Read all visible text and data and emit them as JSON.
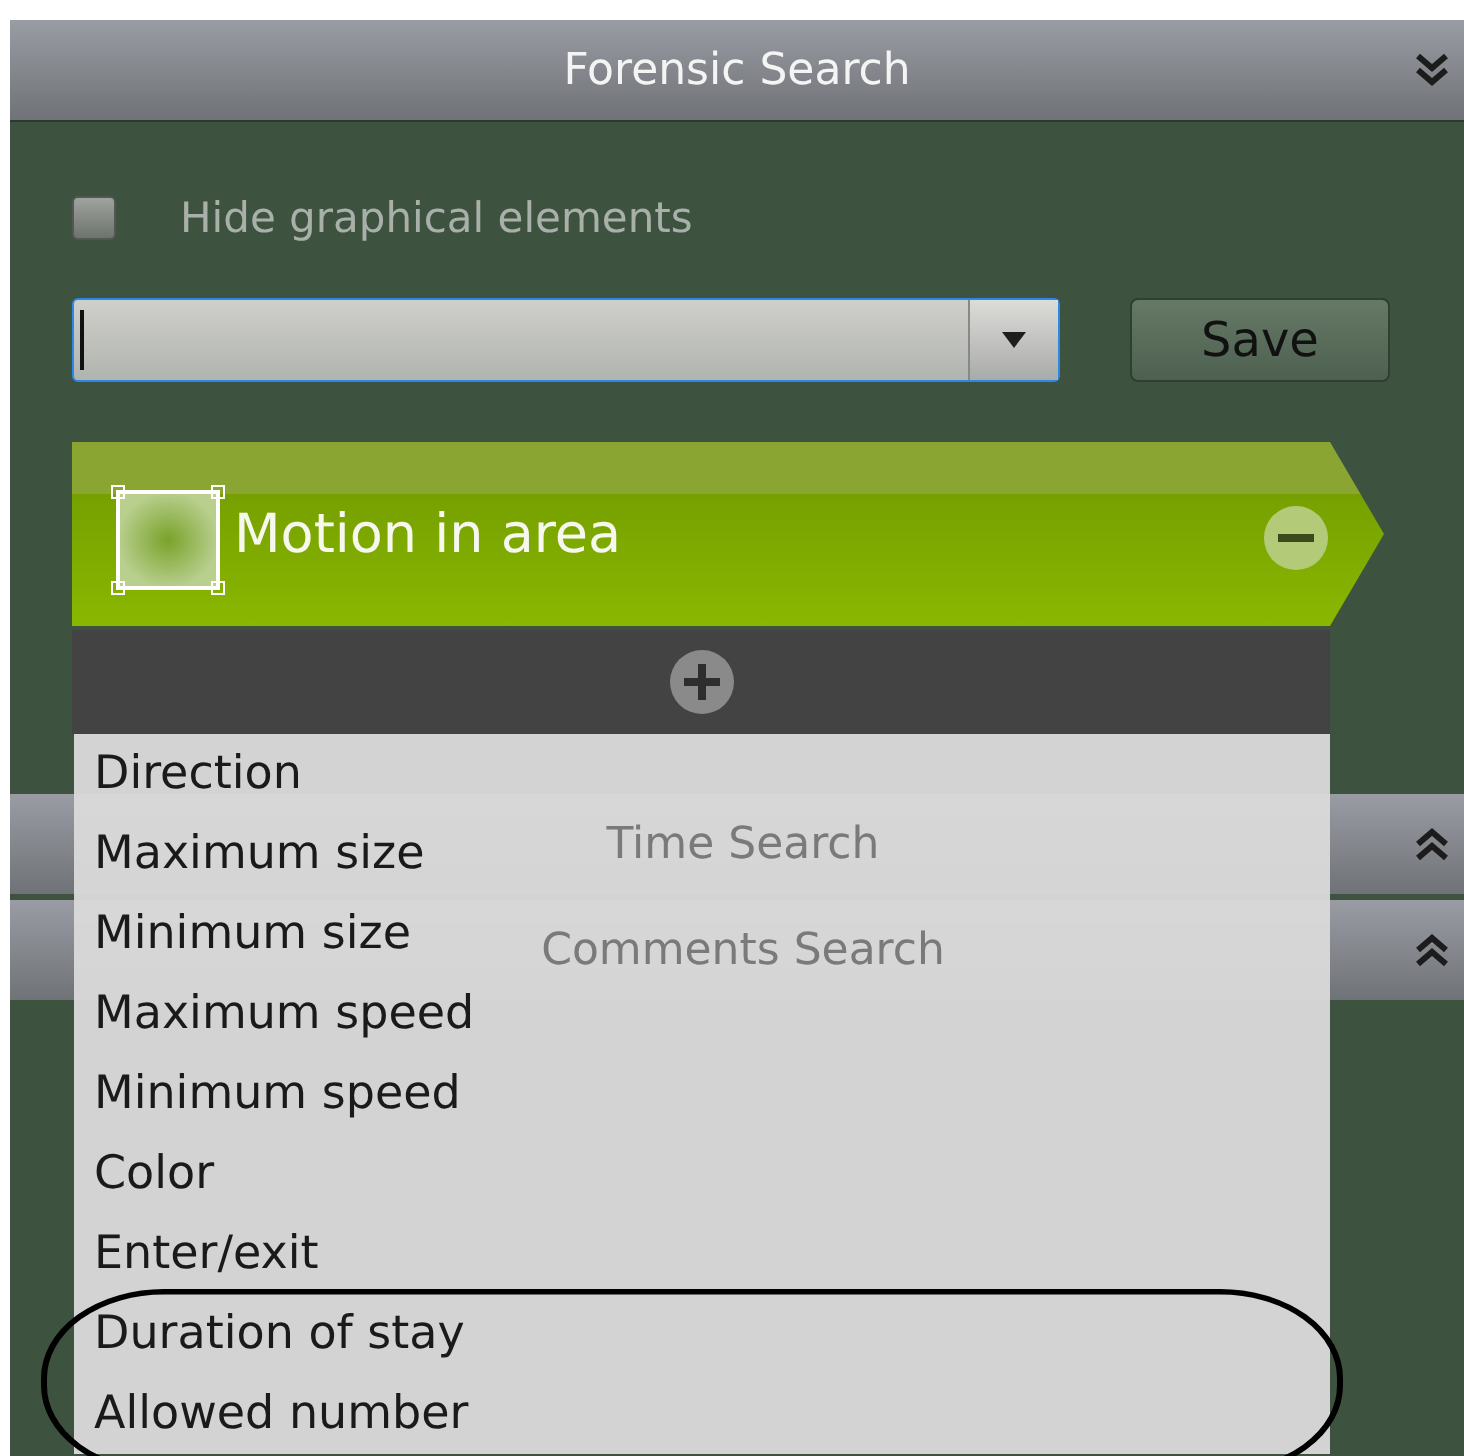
{
  "panel": {
    "title": "Forensic Search",
    "expanded": true
  },
  "hide_graphics": {
    "label": "Hide graphical elements",
    "checked": false
  },
  "save_button": {
    "label": "Save"
  },
  "filter": {
    "title": "Motion in area"
  },
  "condition_menu": {
    "items": [
      {
        "label": "Direction"
      },
      {
        "label": "Maximum size"
      },
      {
        "label": "Minimum size"
      },
      {
        "label": "Maximum speed"
      },
      {
        "label": "Minimum speed"
      },
      {
        "label": "Color"
      },
      {
        "label": "Enter/exit"
      },
      {
        "label": "Duration of stay",
        "circled": true
      },
      {
        "label": "Allowed number",
        "circled": true
      }
    ]
  },
  "sections": [
    {
      "title": "Time Search",
      "expanded": false
    },
    {
      "title": "Comments Search",
      "expanded": false
    }
  ]
}
